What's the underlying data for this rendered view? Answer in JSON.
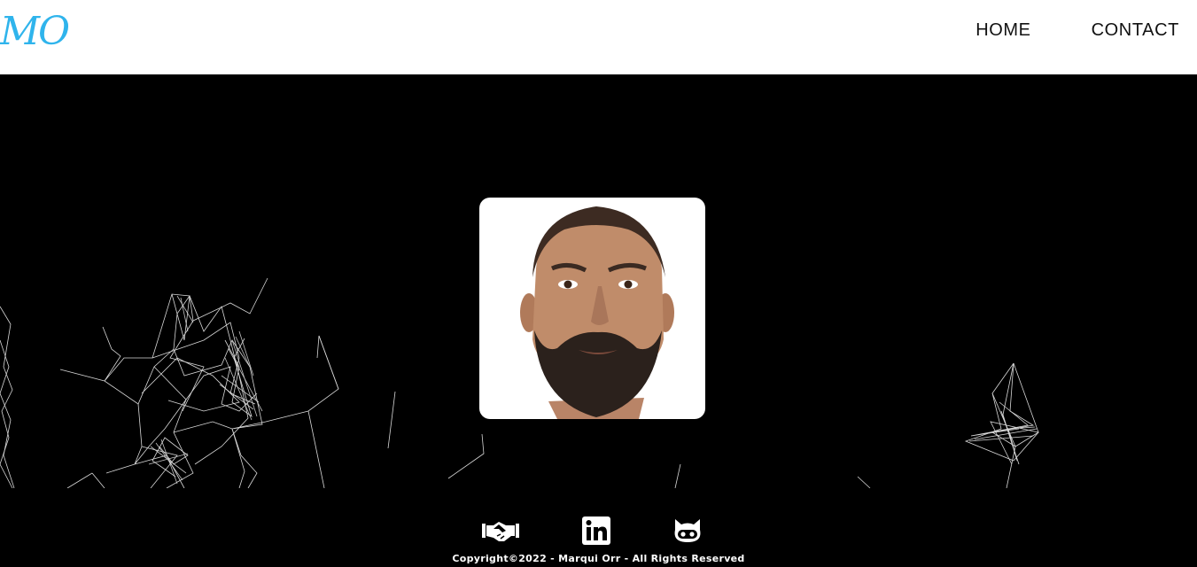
{
  "header": {
    "logo": "MO",
    "nav": [
      {
        "label": "HOME"
      },
      {
        "label": "CONTACT"
      }
    ]
  },
  "colors": {
    "logo": "#2fb4ec",
    "hero_background": "#000000",
    "network_lines": "#ffffff"
  },
  "hero": {
    "portrait_alt": "Portrait photo"
  },
  "footer": {
    "social_icons": [
      "handshake-icon",
      "linkedin-icon",
      "github-icon"
    ],
    "copyright": "Copyright©2022 - Marqui Orr - All Rights Reserved"
  }
}
